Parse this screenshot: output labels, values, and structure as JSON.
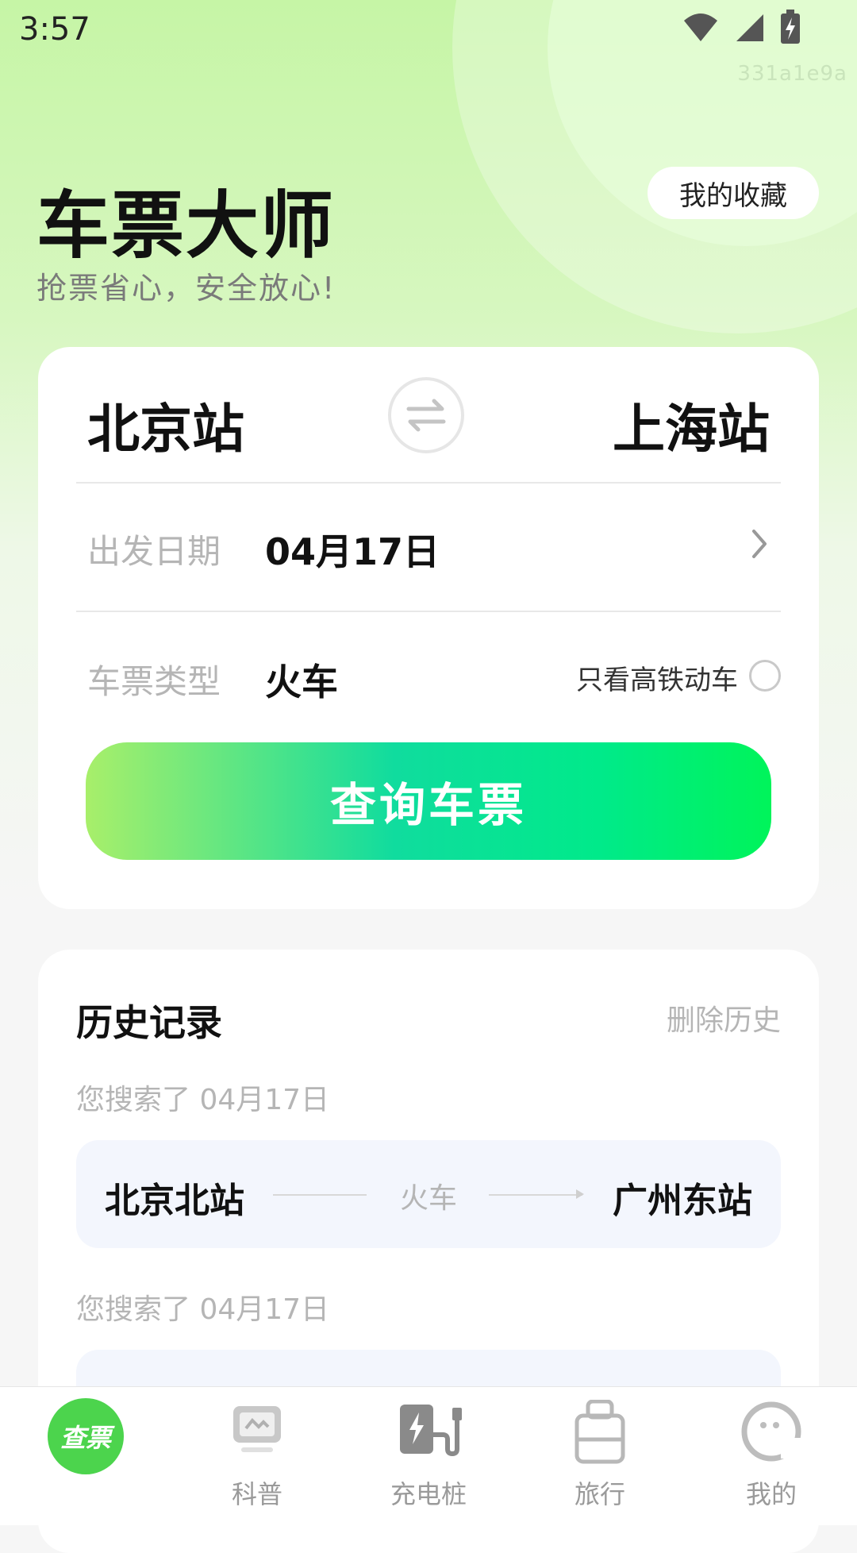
{
  "status_bar": {
    "time": "3:57",
    "device_id": "331a1e9a",
    "icons": [
      "wifi-icon",
      "signal-icon",
      "battery-charging-icon"
    ]
  },
  "header": {
    "title": "车票大师",
    "subtitle": "抢票省心，安全放心!",
    "favorites_label": "我的收藏"
  },
  "search": {
    "from": "北京站",
    "to": "上海站",
    "date_label": "出发日期",
    "date_value": "04月17日",
    "type_label": "车票类型",
    "type_value": "火车",
    "only_high_speed_label": "只看高铁动车",
    "only_high_speed_checked": false,
    "query_button": "查询车票"
  },
  "history": {
    "title": "历史记录",
    "delete_label": "删除历史",
    "entries": [
      {
        "note": "您搜索了 04月17日",
        "from": "北京北站",
        "type": "火车",
        "to": "广州东站"
      },
      {
        "note": "您搜索了 04月17日",
        "from": "",
        "type": "",
        "to": ""
      }
    ]
  },
  "bottom_nav": {
    "items": [
      {
        "label": "查票",
        "icon": "ticket-check-icon",
        "active": true
      },
      {
        "label": "科普",
        "icon": "tv-icon",
        "active": false
      },
      {
        "label": "充电桩",
        "icon": "charging-station-icon",
        "active": false
      },
      {
        "label": "旅行",
        "icon": "luggage-icon",
        "active": false
      },
      {
        "label": "我的",
        "icon": "profile-icon",
        "active": false
      }
    ]
  },
  "colors": {
    "accent_green": "#4cd44d",
    "gradient_start": "#a8ef6a",
    "gradient_end": "#00f45a"
  }
}
